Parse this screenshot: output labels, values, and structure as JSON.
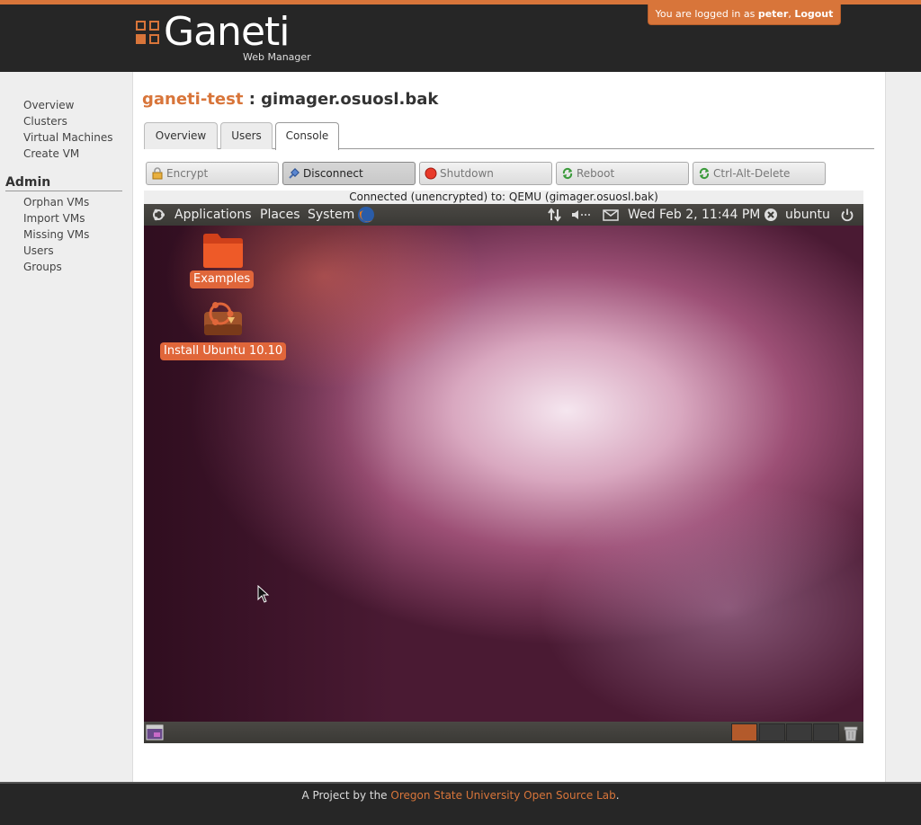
{
  "header": {
    "logo_text": "Ganeti",
    "logo_sub": "Web Manager",
    "login_prefix": "You are logged in as ",
    "username": "peter",
    "login_sep": ", ",
    "logout": "Logout"
  },
  "sidebar": {
    "items": [
      {
        "label": "Overview"
      },
      {
        "label": "Clusters"
      },
      {
        "label": "Virtual Machines"
      },
      {
        "label": "Create VM"
      }
    ],
    "admin_heading": "Admin",
    "admin_items": [
      {
        "label": "Orphan VMs"
      },
      {
        "label": "Import VMs"
      },
      {
        "label": "Missing VMs"
      },
      {
        "label": "Users"
      },
      {
        "label": "Groups"
      }
    ]
  },
  "page": {
    "cluster": "ganeti-test",
    "separator": " : ",
    "vm": "gimager.osuosl.bak"
  },
  "tabs": [
    {
      "label": "Overview"
    },
    {
      "label": "Users"
    },
    {
      "label": "Console",
      "active": true
    }
  ],
  "console": {
    "buttons": [
      {
        "label": "Encrypt",
        "icon": "lock-icon"
      },
      {
        "label": "Disconnect",
        "icon": "plug-icon",
        "pressed": true
      },
      {
        "label": "Shutdown",
        "icon": "red-circle-icon"
      },
      {
        "label": "Reboot",
        "icon": "refresh-icon"
      },
      {
        "label": "Ctrl-Alt-Delete",
        "icon": "refresh-icon"
      }
    ],
    "status": "Connected (unencrypted) to: QEMU (gimager.osuosl.bak)"
  },
  "desktop": {
    "menus": {
      "applications": "Applications",
      "places": "Places",
      "system": "System"
    },
    "clock": "Wed Feb 2, 11:44 PM",
    "user": "ubuntu",
    "icons": [
      {
        "label": "Examples",
        "icon": "folder-icon"
      },
      {
        "label": "Install Ubuntu 10.10",
        "icon": "installer-icon"
      }
    ]
  },
  "footer": {
    "prefix": "A Project by the ",
    "link": "Oregon State University Open Source Lab",
    "suffix": "."
  },
  "colors": {
    "accent": "#d8753a",
    "header_bg": "#262626"
  }
}
